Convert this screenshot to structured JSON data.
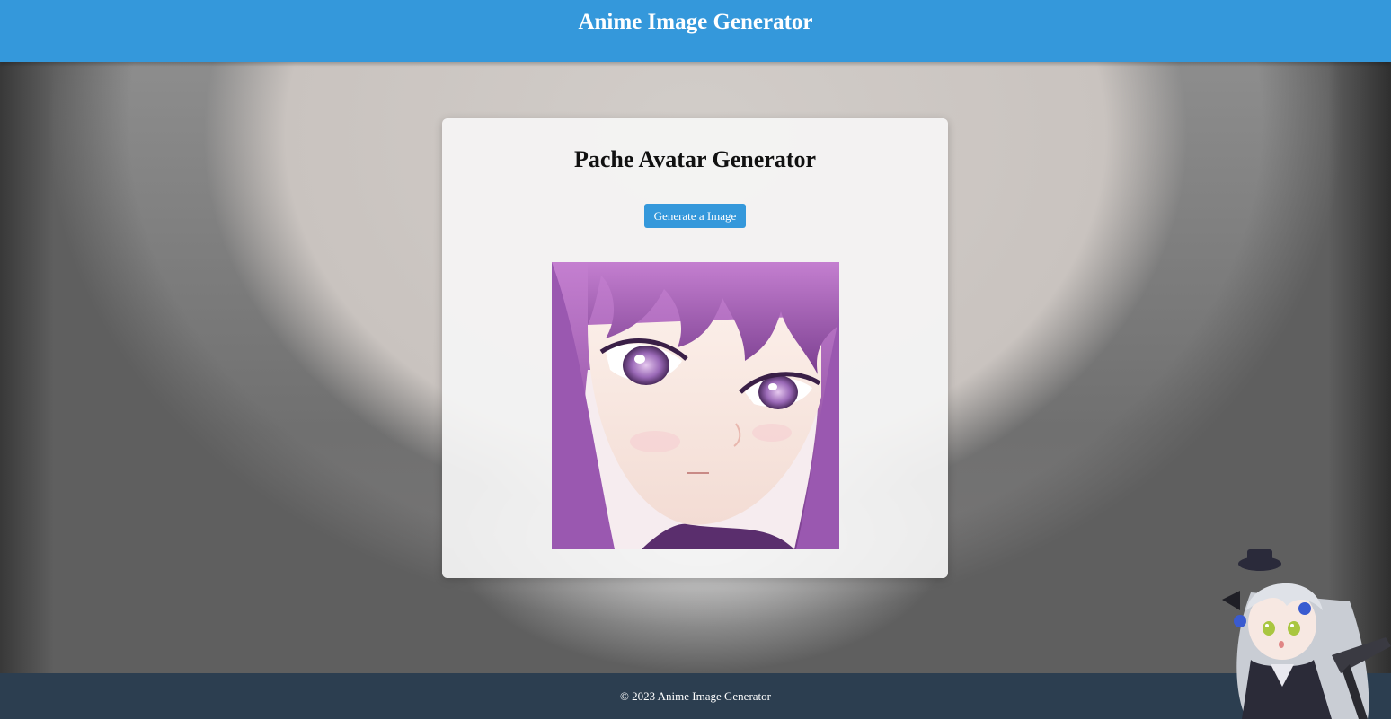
{
  "header": {
    "title": "Anime Image Generator"
  },
  "card": {
    "title": "Pache Avatar Generator",
    "button_label": "Generate a Image"
  },
  "footer": {
    "text": "© 2023 Anime Image Generator"
  },
  "colors": {
    "header_bg": "#3498db",
    "button_bg": "#3498db",
    "footer_bg": "#2c3e50",
    "avatar_hair": "#b46cc8",
    "avatar_eyes": "#8a5fa8"
  },
  "icons": {
    "generated_image": "anime-girl-purple-hair-portrait",
    "mascot": "chibi-anime-girl-silver-hair"
  }
}
